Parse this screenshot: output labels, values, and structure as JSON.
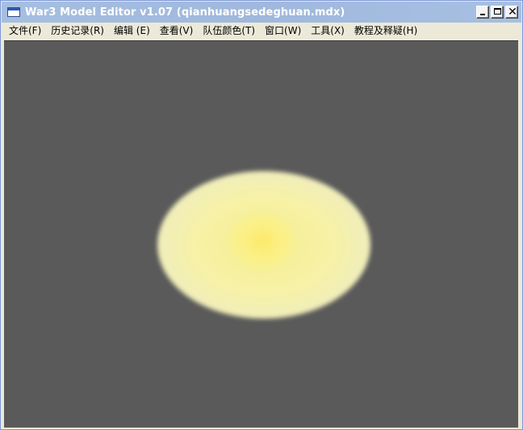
{
  "window": {
    "title": "War3 Model Editor v1.07 (qianhuangsedeghuan.mdx)",
    "icon": "application-window-icon",
    "controls": [
      "minimize-icon",
      "maximize-icon",
      "close-icon"
    ],
    "close_glyph": "✕"
  },
  "menu": {
    "items": [
      {
        "label": "文件(F)"
      },
      {
        "label": "历史记录(R)"
      },
      {
        "label": "编辑 (E)"
      },
      {
        "label": "查看(V)"
      },
      {
        "label": "队伍颜色(T)"
      },
      {
        "label": "窗口(W)"
      },
      {
        "label": "工具(X)"
      },
      {
        "label": "教程及释疑(H)"
      }
    ]
  },
  "viewport": {
    "background_color": "#5a5a5a",
    "model_glow_color": "#fff7a0"
  }
}
